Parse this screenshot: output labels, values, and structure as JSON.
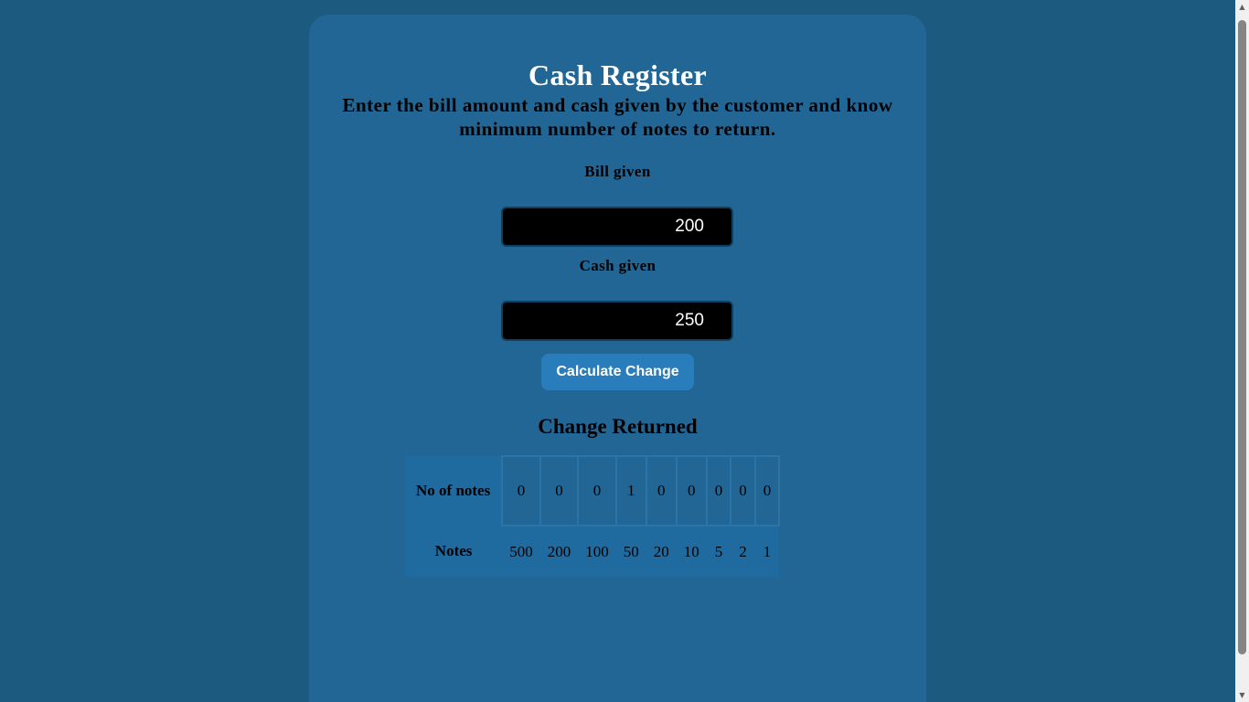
{
  "app": {
    "title": "Cash Register",
    "description": "Enter the bill amount and cash given by the customer and know minimum number of notes to return."
  },
  "form": {
    "bill_label": "Bill given",
    "bill_value": "200",
    "cash_label": "Cash given",
    "cash_value": "250",
    "button_label": "Calculate Change"
  },
  "result": {
    "title": "Change Returned",
    "row_count_header": "No of notes",
    "row_notes_header": "Notes",
    "counts": [
      "0",
      "0",
      "0",
      "1",
      "0",
      "0",
      "0",
      "0",
      "0"
    ],
    "notes": [
      "500",
      "200",
      "100",
      "50",
      "20",
      "10",
      "5",
      "2",
      "1"
    ]
  },
  "colors": {
    "page_background": "#1c5a80",
    "card_background": "#226695",
    "button_background": "#2a7dbb",
    "input_background": "#000000"
  },
  "icons": {
    "scroll_up": "triangle-up-icon",
    "scroll_down": "triangle-down-icon"
  }
}
